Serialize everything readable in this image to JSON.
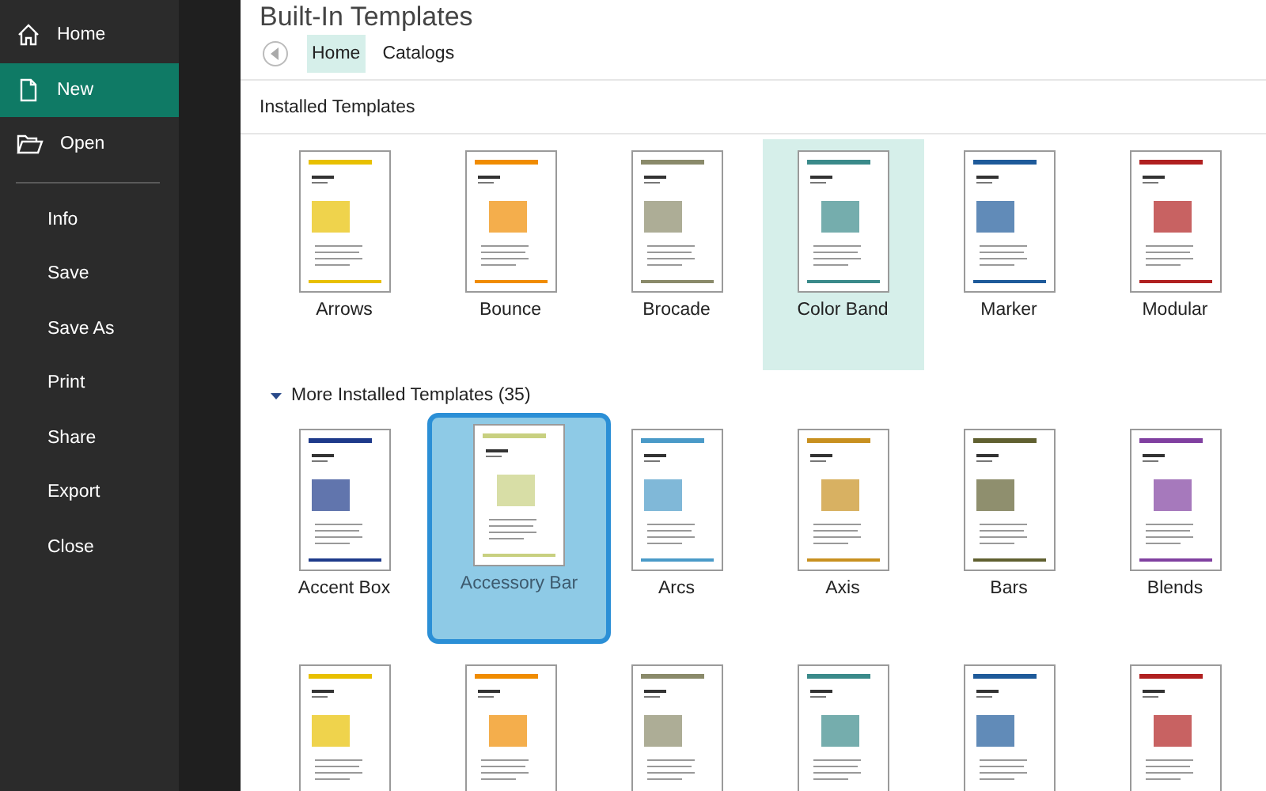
{
  "sidebar": {
    "items": [
      {
        "label": "Home",
        "kind": "icon",
        "selected": false
      },
      {
        "label": "New",
        "kind": "icon",
        "selected": true
      },
      {
        "label": "Open",
        "kind": "icon",
        "selected": false
      },
      {
        "label": "Info",
        "kind": "text",
        "selected": false
      },
      {
        "label": "Save",
        "kind": "text",
        "selected": false
      },
      {
        "label": "Save As",
        "kind": "text",
        "selected": false
      },
      {
        "label": "Print",
        "kind": "text",
        "selected": false
      },
      {
        "label": "Share",
        "kind": "text",
        "selected": false
      },
      {
        "label": "Export",
        "kind": "text",
        "selected": false
      },
      {
        "label": "Close",
        "kind": "text",
        "selected": false
      }
    ]
  },
  "title": "Built-In Templates",
  "tabs": [
    {
      "label": "Home",
      "selected": true
    },
    {
      "label": "Catalogs",
      "selected": false
    }
  ],
  "sections": [
    {
      "heading": "Installed Templates",
      "templates": [
        {
          "label": "Arrows",
          "selected": false,
          "focused": false
        },
        {
          "label": "Bounce",
          "selected": false,
          "focused": false
        },
        {
          "label": "Brocade",
          "selected": false,
          "focused": false
        },
        {
          "label": "Color Band",
          "selected": true,
          "focused": false
        },
        {
          "label": "Marker",
          "selected": false,
          "focused": false
        },
        {
          "label": "Modular",
          "selected": false,
          "focused": false
        }
      ]
    },
    {
      "heading": "More Installed Templates (35)",
      "expanded": true,
      "templates": [
        {
          "label": "Accent Box",
          "selected": false,
          "focused": false
        },
        {
          "label": "Accessory Bar",
          "selected": true,
          "focused": true
        },
        {
          "label": "Arcs",
          "selected": false,
          "focused": false
        },
        {
          "label": "Axis",
          "selected": false,
          "focused": false
        },
        {
          "label": "Bars",
          "selected": false,
          "focused": false
        },
        {
          "label": "Blends",
          "selected": false,
          "focused": false
        },
        {
          "selected": false,
          "focused": false
        },
        {
          "selected": false,
          "focused": false
        },
        {
          "selected": false,
          "focused": false
        },
        {
          "selected": false,
          "focused": false
        },
        {
          "selected": false,
          "focused": false
        },
        {
          "selected": false,
          "focused": false
        }
      ]
    }
  ]
}
